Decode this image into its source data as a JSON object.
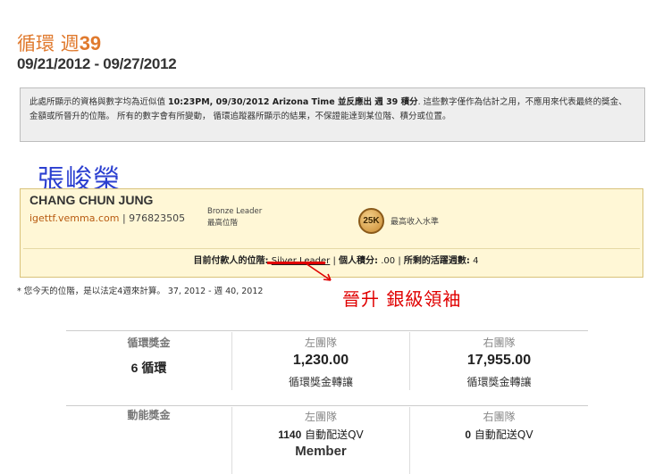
{
  "cycle": {
    "label": "循環 週",
    "number": "39",
    "date_range": "09/21/2012 - 09/27/2012"
  },
  "notice": {
    "part1": "此處所顯示的資格與數字均為近似值 ",
    "time": "10:23PM, 09/30/2012 Arizona Time",
    "part2": " 並反應出 ",
    "week": "週 39 積分",
    "part3": ". 這些數字僅作為估計之用，不應用來代表最終的獎金、金額或所晉升的位階。 所有的數字會有所變動， 循環追蹤器所顯示的結果，不保證能達到某位階、積分或位置。"
  },
  "member": {
    "chinese_name": "張峻榮",
    "english_name": "CHANG CHUN JUNG",
    "website": "igettf.vemma.com",
    "separator": "|",
    "id": "976823505",
    "highest_rank": "Bronze Leader",
    "highest_rank_label": "最高位階",
    "income_badge": "25K",
    "income_label": "最高收入水準"
  },
  "status": {
    "paid_rank_label": "目前付款人的位階:",
    "paid_rank_value": "Silver Leader",
    "personal_points_label": "個人積分:",
    "personal_points_value": ".00",
    "active_weeks_label": "所剩的活躍週數:",
    "active_weeks_value": "4",
    "sep": "|"
  },
  "note": "* 您今天的位階，是以法定4週來計算。 37, 2012 - 週 40, 2012",
  "promotion_annotation": "晉升 銀級領袖",
  "cycle_bonus": {
    "title": "循環獎金",
    "cycles": "6 循環",
    "left_header": "左團隊",
    "left_value": "1,230.00",
    "left_sub": "循環獎金轉讓",
    "right_header": "右團隊",
    "right_value": "17,955.00",
    "right_sub": "循環獎金轉讓"
  },
  "momentum_bonus": {
    "title": "動能獎金",
    "left_header": "左團隊",
    "left_count": "1140",
    "left_text": " 自動配送QV",
    "right_header": "右團隊",
    "right_count": "0",
    "right_text": " 自動配送QV",
    "member_label": "Member"
  },
  "colors": {
    "accent_orange": "#e07a2e",
    "chinese_name_blue": "#2b3fd0",
    "annotation_red": "#e00000",
    "member_box_bg": "#fff7d6"
  }
}
